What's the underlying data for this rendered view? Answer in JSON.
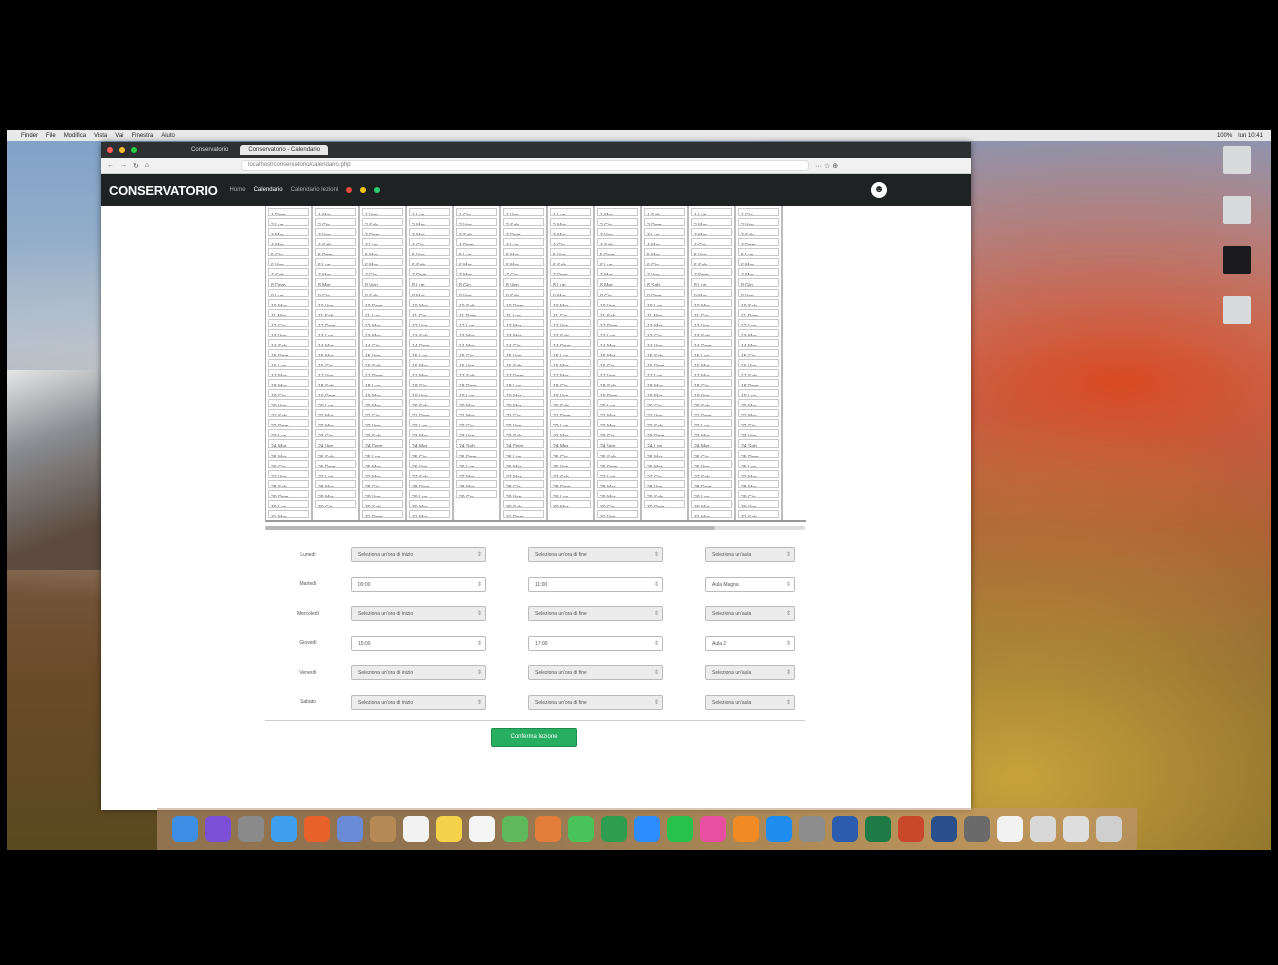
{
  "browser": {
    "tabs": [
      {
        "label": "Conservatorio",
        "active": false
      },
      {
        "label": "Conservatorio - Calendario",
        "active": true
      }
    ],
    "url": "localhost/conservatorio/calendario.php",
    "toolbar_text": "··· ☆ ⊕"
  },
  "navbar": {
    "brand": "CONSERVATORIO",
    "links": [
      "Home",
      "Calendario",
      "Calendario lezioni"
    ],
    "status_colors": [
      "#e74c3c",
      "#f1c40f",
      "#2ecc71"
    ]
  },
  "calendar": {
    "columns": [
      [
        "1 Dom",
        "2 Lun",
        "3 Mar",
        "4 Mer",
        "5 Gio",
        "6 Ven",
        "7 Sab",
        "8 Dom",
        "9 Lun",
        "10 Mar",
        "11 Mer",
        "12 Gio",
        "13 Ven",
        "14 Sab",
        "15 Dom",
        "16 Lun",
        "17 Mar",
        "18 Mer",
        "19 Gio",
        "20 Ven",
        "21 Sab",
        "22 Dom",
        "23 Lun",
        "24 Mar",
        "25 Mer",
        "26 Gio",
        "27 Ven",
        "28 Sab",
        "29 Dom",
        "30 Lun",
        "31 Mar"
      ],
      [
        "1 Mer",
        "2 Gio",
        "3 Ven",
        "4 Sab",
        "5 Dom",
        "6 Lun",
        "7 Mar",
        "8 Mer",
        "9 Gio",
        "10 Ven",
        "11 Sab",
        "12 Dom",
        "13 Lun",
        "14 Mar",
        "15 Mer",
        "16 Gio",
        "17 Ven",
        "18 Sab",
        "19 Dom",
        "20 Lun",
        "21 Mar",
        "22 Mer",
        "23 Gio",
        "24 Ven",
        "25 Sab",
        "26 Dom",
        "27 Lun",
        "28 Mar",
        "29 Mer",
        "30 Gio",
        ""
      ],
      [
        "1 Ven",
        "2 Sab",
        "3 Dom",
        "4 Lun",
        "5 Mar",
        "6 Mer",
        "7 Gio",
        "8 Ven",
        "9 Sab",
        "10 Dom",
        "11 Lun",
        "12 Mar",
        "13 Mer",
        "14 Gio",
        "15 Ven",
        "16 Sab",
        "17 Dom",
        "18 Lun",
        "19 Mar",
        "20 Mer",
        "21 Gio",
        "22 Ven",
        "23 Sab",
        "24 Dom",
        "25 Lun",
        "26 Mar",
        "27 Mer",
        "28 Gio",
        "29 Ven",
        "30 Sab",
        "31 Dom"
      ],
      [
        "1 Lun",
        "2 Mar",
        "3 Mer",
        "4 Gio",
        "5 Ven",
        "6 Sab",
        "7 Dom",
        "8 Lun",
        "9 Mar",
        "10 Mer",
        "11 Gio",
        "12 Ven",
        "13 Sab",
        "14 Dom",
        "15 Lun",
        "16 Mar",
        "17 Mer",
        "18 Gio",
        "19 Ven",
        "20 Sab",
        "21 Dom",
        "22 Lun",
        "23 Mar",
        "24 Mer",
        "25 Gio",
        "26 Ven",
        "27 Sab",
        "28 Dom",
        "29 Lun",
        "30 Mar",
        "31 Mer"
      ],
      [
        "1 Gio",
        "2 Ven",
        "3 Sab",
        "4 Dom",
        "5 Lun",
        "6 Mar",
        "7 Mer",
        "8 Gio",
        "9 Ven",
        "10 Sab",
        "11 Dom",
        "12 Lun",
        "13 Mar",
        "14 Mer",
        "15 Gio",
        "16 Ven",
        "17 Sab",
        "18 Dom",
        "19 Lun",
        "20 Mar",
        "21 Mer",
        "22 Gio",
        "23 Ven",
        "24 Sab",
        "25 Dom",
        "26 Lun",
        "27 Mar",
        "28 Mer",
        "29 Gio",
        "",
        ""
      ],
      [
        "1 Ven",
        "2 Sab",
        "3 Dom",
        "4 Lun",
        "5 Mar",
        "6 Mer",
        "7 Gio",
        "8 Ven",
        "9 Sab",
        "10 Dom",
        "11 Lun",
        "12 Mar",
        "13 Mer",
        "14 Gio",
        "15 Ven",
        "16 Sab",
        "17 Dom",
        "18 Lun",
        "19 Mar",
        "20 Mer",
        "21 Gio",
        "22 Ven",
        "23 Sab",
        "24 Dom",
        "25 Lun",
        "26 Mar",
        "27 Mer",
        "28 Gio",
        "29 Ven",
        "30 Sab",
        "31 Dom"
      ],
      [
        "1 Lun",
        "2 Mar",
        "3 Mer",
        "4 Gio",
        "5 Ven",
        "6 Sab",
        "7 Dom",
        "8 Lun",
        "9 Mar",
        "10 Mer",
        "11 Gio",
        "12 Ven",
        "13 Sab",
        "14 Dom",
        "15 Lun",
        "16 Mar",
        "17 Mer",
        "18 Gio",
        "19 Ven",
        "20 Sab",
        "21 Dom",
        "22 Lun",
        "23 Mar",
        "24 Mer",
        "25 Gio",
        "26 Ven",
        "27 Sab",
        "28 Dom",
        "29 Lun",
        "30 Mar",
        ""
      ],
      [
        "1 Mer",
        "2 Gio",
        "3 Ven",
        "4 Sab",
        "5 Dom",
        "6 Lun",
        "7 Mar",
        "8 Mer",
        "9 Gio",
        "10 Ven",
        "11 Sab",
        "12 Dom",
        "13 Lun",
        "14 Mar",
        "15 Mer",
        "16 Gio",
        "17 Ven",
        "18 Sab",
        "19 Dom",
        "20 Lun",
        "21 Mar",
        "22 Mer",
        "23 Gio",
        "24 Ven",
        "25 Sab",
        "26 Dom",
        "27 Lun",
        "28 Mar",
        "29 Mer",
        "30 Gio",
        "31 Ven"
      ],
      [
        "1 Sab",
        "2 Dom",
        "3 Lun",
        "4 Mar",
        "5 Mer",
        "6 Gio",
        "7 Ven",
        "8 Sab",
        "9 Dom",
        "10 Lun",
        "11 Mar",
        "12 Mer",
        "13 Gio",
        "14 Ven",
        "15 Sab",
        "16 Dom",
        "17 Lun",
        "18 Mar",
        "19 Mer",
        "20 Gio",
        "21 Ven",
        "22 Sab",
        "23 Dom",
        "24 Lun",
        "25 Mar",
        "26 Mer",
        "27 Gio",
        "28 Ven",
        "29 Sab",
        "30 Dom",
        ""
      ],
      [
        "1 Lun",
        "2 Mar",
        "3 Mer",
        "4 Gio",
        "5 Ven",
        "6 Sab",
        "7 Dom",
        "8 Lun",
        "9 Mar",
        "10 Mer",
        "11 Gio",
        "12 Ven",
        "13 Sab",
        "14 Dom",
        "15 Lun",
        "16 Mar",
        "17 Mer",
        "18 Gio",
        "19 Ven",
        "20 Sab",
        "21 Dom",
        "22 Lun",
        "23 Mar",
        "24 Mer",
        "25 Gio",
        "26 Ven",
        "27 Sab",
        "28 Dom",
        "29 Lun",
        "30 Mar",
        "31 Mer"
      ],
      [
        "1 Gio",
        "2 Ven",
        "3 Sab",
        "4 Dom",
        "5 Lun",
        "6 Mar",
        "7 Mer",
        "8 Gio",
        "9 Ven",
        "10 Sab",
        "11 Dom",
        "12 Lun",
        "13 Mar",
        "14 Mer",
        "15 Gio",
        "16 Ven",
        "17 Sab",
        "18 Dom",
        "19 Lun",
        "20 Mar",
        "21 Mer",
        "22 Gio",
        "23 Ven",
        "24 Sab",
        "25 Dom",
        "26 Lun",
        "27 Mar",
        "28 Mer",
        "29 Gio",
        "30 Ven",
        "31 Sab"
      ]
    ]
  },
  "form": {
    "rows": [
      {
        "label": "Lunedì",
        "sel1": "Seleziona un'ora di inizio",
        "sel2": "Seleziona un'ora di fine",
        "sel3": "Seleziona un'aula",
        "white": [
          false,
          false,
          false
        ]
      },
      {
        "label": "Martedì",
        "sel1": "09:00",
        "sel2": "11:00",
        "sel3": "Aula Magna",
        "white": [
          true,
          true,
          true
        ]
      },
      {
        "label": "Mercoledì",
        "sel1": "Seleziona un'ora di inizio",
        "sel2": "Seleziona un'ora di fine",
        "sel3": "Seleziona un'aula",
        "white": [
          false,
          false,
          false
        ]
      },
      {
        "label": "Giovedì",
        "sel1": "15:00",
        "sel2": "17:00",
        "sel3": "Aula 2",
        "white": [
          true,
          true,
          true
        ]
      },
      {
        "label": "Venerdì",
        "sel1": "Seleziona un'ora di inizio",
        "sel2": "Seleziona un'ora di fine",
        "sel3": "Seleziona un'aula",
        "white": [
          false,
          false,
          false
        ]
      },
      {
        "label": "Sabato",
        "sel1": "Seleziona un'ora di inizio",
        "sel2": "Seleziona un'ora di fine",
        "sel3": "Seleziona un'aula",
        "white": [
          false,
          false,
          false
        ]
      }
    ],
    "submit_label": "Conferma lezione"
  },
  "mac_menubar": {
    "items": [
      "Finder",
      "File",
      "Modifica",
      "Vista",
      "Vai",
      "Finestra",
      "Aiuto"
    ],
    "right": [
      "100%",
      "lun 10:41"
    ]
  },
  "dock": {
    "icons": [
      {
        "name": "finder-icon",
        "color": "#3d8fe6"
      },
      {
        "name": "siri-icon",
        "color": "#7b4fd6"
      },
      {
        "name": "launchpad-icon",
        "color": "#8a8a8a"
      },
      {
        "name": "safari-icon",
        "color": "#3fa0ef"
      },
      {
        "name": "firefox-icon",
        "color": "#e8612b"
      },
      {
        "name": "mail-icon",
        "color": "#6b8bd6"
      },
      {
        "name": "contacts-icon",
        "color": "#b58a55"
      },
      {
        "name": "calendar-icon",
        "color": "#f2f2f2"
      },
      {
        "name": "notes-icon",
        "color": "#f4d34a"
      },
      {
        "name": "reminders-icon",
        "color": "#f5f5f5"
      },
      {
        "name": "maps-icon",
        "color": "#5fb85a"
      },
      {
        "name": "photos-icon",
        "color": "#e27c3a"
      },
      {
        "name": "messages-icon",
        "color": "#4ac25a"
      },
      {
        "name": "facetime-icon",
        "color": "#2e9d4d"
      },
      {
        "name": "zoom-icon",
        "color": "#2d8cff"
      },
      {
        "name": "whatsapp-icon",
        "color": "#27c24c"
      },
      {
        "name": "itunes-icon",
        "color": "#e84fa0"
      },
      {
        "name": "books-icon",
        "color": "#f08a24"
      },
      {
        "name": "appstore-icon",
        "color": "#1e8cf0"
      },
      {
        "name": "settings-icon",
        "color": "#8d8d8d"
      },
      {
        "name": "word-icon",
        "color": "#2b5cae"
      },
      {
        "name": "excel-icon",
        "color": "#1e7b45"
      },
      {
        "name": "powerpoint-icon",
        "color": "#c9472a"
      },
      {
        "name": "vpn-icon",
        "color": "#2a4f8a"
      },
      {
        "name": "downloads-icon",
        "color": "#6a6a6a"
      },
      {
        "name": "document-icon",
        "color": "#f2f2f2"
      },
      {
        "name": "printer-icon",
        "color": "#d8d8d8"
      },
      {
        "name": "preview-icon",
        "color": "#dedede"
      },
      {
        "name": "trash-icon",
        "color": "#cfcfcf"
      }
    ]
  }
}
